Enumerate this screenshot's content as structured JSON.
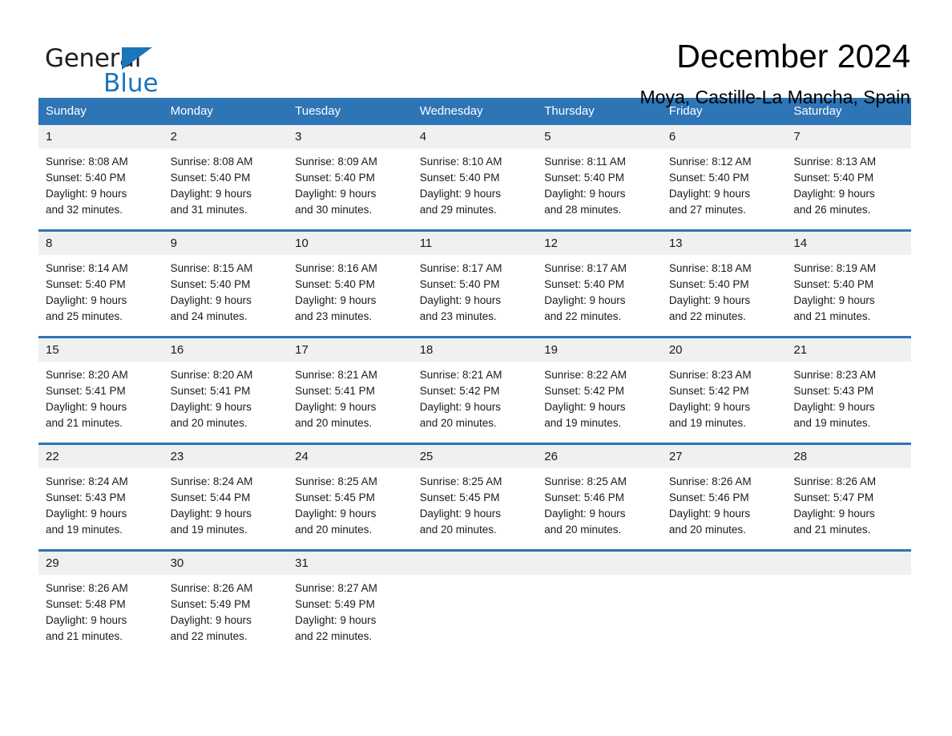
{
  "brand": {
    "name_top": "General",
    "name_bottom": "Blue",
    "accent_color": "#1b75bb"
  },
  "header": {
    "title": "December 2024",
    "location": "Moya, Castille-La Mancha, Spain"
  },
  "theme": {
    "header_blue": "#2e75b6",
    "date_band_gray": "#f0f0f0",
    "text_color": "#1a1a1a"
  },
  "weekday_headers": [
    "Sunday",
    "Monday",
    "Tuesday",
    "Wednesday",
    "Thursday",
    "Friday",
    "Saturday"
  ],
  "labels": {
    "sunrise_prefix": "Sunrise:",
    "sunset_prefix": "Sunset:",
    "daylight_prefix": "Daylight:"
  },
  "weeks": [
    [
      {
        "day": "1",
        "sunrise": "Sunrise: 8:08 AM",
        "sunset": "Sunset: 5:40 PM",
        "daylight_1": "Daylight: 9 hours",
        "daylight_2": "and 32 minutes."
      },
      {
        "day": "2",
        "sunrise": "Sunrise: 8:08 AM",
        "sunset": "Sunset: 5:40 PM",
        "daylight_1": "Daylight: 9 hours",
        "daylight_2": "and 31 minutes."
      },
      {
        "day": "3",
        "sunrise": "Sunrise: 8:09 AM",
        "sunset": "Sunset: 5:40 PM",
        "daylight_1": "Daylight: 9 hours",
        "daylight_2": "and 30 minutes."
      },
      {
        "day": "4",
        "sunrise": "Sunrise: 8:10 AM",
        "sunset": "Sunset: 5:40 PM",
        "daylight_1": "Daylight: 9 hours",
        "daylight_2": "and 29 minutes."
      },
      {
        "day": "5",
        "sunrise": "Sunrise: 8:11 AM",
        "sunset": "Sunset: 5:40 PM",
        "daylight_1": "Daylight: 9 hours",
        "daylight_2": "and 28 minutes."
      },
      {
        "day": "6",
        "sunrise": "Sunrise: 8:12 AM",
        "sunset": "Sunset: 5:40 PM",
        "daylight_1": "Daylight: 9 hours",
        "daylight_2": "and 27 minutes."
      },
      {
        "day": "7",
        "sunrise": "Sunrise: 8:13 AM",
        "sunset": "Sunset: 5:40 PM",
        "daylight_1": "Daylight: 9 hours",
        "daylight_2": "and 26 minutes."
      }
    ],
    [
      {
        "day": "8",
        "sunrise": "Sunrise: 8:14 AM",
        "sunset": "Sunset: 5:40 PM",
        "daylight_1": "Daylight: 9 hours",
        "daylight_2": "and 25 minutes."
      },
      {
        "day": "9",
        "sunrise": "Sunrise: 8:15 AM",
        "sunset": "Sunset: 5:40 PM",
        "daylight_1": "Daylight: 9 hours",
        "daylight_2": "and 24 minutes."
      },
      {
        "day": "10",
        "sunrise": "Sunrise: 8:16 AM",
        "sunset": "Sunset: 5:40 PM",
        "daylight_1": "Daylight: 9 hours",
        "daylight_2": "and 23 minutes."
      },
      {
        "day": "11",
        "sunrise": "Sunrise: 8:17 AM",
        "sunset": "Sunset: 5:40 PM",
        "daylight_1": "Daylight: 9 hours",
        "daylight_2": "and 23 minutes."
      },
      {
        "day": "12",
        "sunrise": "Sunrise: 8:17 AM",
        "sunset": "Sunset: 5:40 PM",
        "daylight_1": "Daylight: 9 hours",
        "daylight_2": "and 22 minutes."
      },
      {
        "day": "13",
        "sunrise": "Sunrise: 8:18 AM",
        "sunset": "Sunset: 5:40 PM",
        "daylight_1": "Daylight: 9 hours",
        "daylight_2": "and 22 minutes."
      },
      {
        "day": "14",
        "sunrise": "Sunrise: 8:19 AM",
        "sunset": "Sunset: 5:40 PM",
        "daylight_1": "Daylight: 9 hours",
        "daylight_2": "and 21 minutes."
      }
    ],
    [
      {
        "day": "15",
        "sunrise": "Sunrise: 8:20 AM",
        "sunset": "Sunset: 5:41 PM",
        "daylight_1": "Daylight: 9 hours",
        "daylight_2": "and 21 minutes."
      },
      {
        "day": "16",
        "sunrise": "Sunrise: 8:20 AM",
        "sunset": "Sunset: 5:41 PM",
        "daylight_1": "Daylight: 9 hours",
        "daylight_2": "and 20 minutes."
      },
      {
        "day": "17",
        "sunrise": "Sunrise: 8:21 AM",
        "sunset": "Sunset: 5:41 PM",
        "daylight_1": "Daylight: 9 hours",
        "daylight_2": "and 20 minutes."
      },
      {
        "day": "18",
        "sunrise": "Sunrise: 8:21 AM",
        "sunset": "Sunset: 5:42 PM",
        "daylight_1": "Daylight: 9 hours",
        "daylight_2": "and 20 minutes."
      },
      {
        "day": "19",
        "sunrise": "Sunrise: 8:22 AM",
        "sunset": "Sunset: 5:42 PM",
        "daylight_1": "Daylight: 9 hours",
        "daylight_2": "and 19 minutes."
      },
      {
        "day": "20",
        "sunrise": "Sunrise: 8:23 AM",
        "sunset": "Sunset: 5:42 PM",
        "daylight_1": "Daylight: 9 hours",
        "daylight_2": "and 19 minutes."
      },
      {
        "day": "21",
        "sunrise": "Sunrise: 8:23 AM",
        "sunset": "Sunset: 5:43 PM",
        "daylight_1": "Daylight: 9 hours",
        "daylight_2": "and 19 minutes."
      }
    ],
    [
      {
        "day": "22",
        "sunrise": "Sunrise: 8:24 AM",
        "sunset": "Sunset: 5:43 PM",
        "daylight_1": "Daylight: 9 hours",
        "daylight_2": "and 19 minutes."
      },
      {
        "day": "23",
        "sunrise": "Sunrise: 8:24 AM",
        "sunset": "Sunset: 5:44 PM",
        "daylight_1": "Daylight: 9 hours",
        "daylight_2": "and 19 minutes."
      },
      {
        "day": "24",
        "sunrise": "Sunrise: 8:25 AM",
        "sunset": "Sunset: 5:45 PM",
        "daylight_1": "Daylight: 9 hours",
        "daylight_2": "and 20 minutes."
      },
      {
        "day": "25",
        "sunrise": "Sunrise: 8:25 AM",
        "sunset": "Sunset: 5:45 PM",
        "daylight_1": "Daylight: 9 hours",
        "daylight_2": "and 20 minutes."
      },
      {
        "day": "26",
        "sunrise": "Sunrise: 8:25 AM",
        "sunset": "Sunset: 5:46 PM",
        "daylight_1": "Daylight: 9 hours",
        "daylight_2": "and 20 minutes."
      },
      {
        "day": "27",
        "sunrise": "Sunrise: 8:26 AM",
        "sunset": "Sunset: 5:46 PM",
        "daylight_1": "Daylight: 9 hours",
        "daylight_2": "and 20 minutes."
      },
      {
        "day": "28",
        "sunrise": "Sunrise: 8:26 AM",
        "sunset": "Sunset: 5:47 PM",
        "daylight_1": "Daylight: 9 hours",
        "daylight_2": "and 21 minutes."
      }
    ],
    [
      {
        "day": "29",
        "sunrise": "Sunrise: 8:26 AM",
        "sunset": "Sunset: 5:48 PM",
        "daylight_1": "Daylight: 9 hours",
        "daylight_2": "and 21 minutes."
      },
      {
        "day": "30",
        "sunrise": "Sunrise: 8:26 AM",
        "sunset": "Sunset: 5:49 PM",
        "daylight_1": "Daylight: 9 hours",
        "daylight_2": "and 22 minutes."
      },
      {
        "day": "31",
        "sunrise": "Sunrise: 8:27 AM",
        "sunset": "Sunset: 5:49 PM",
        "daylight_1": "Daylight: 9 hours",
        "daylight_2": "and 22 minutes."
      },
      {
        "day": "",
        "sunrise": "",
        "sunset": "",
        "daylight_1": "",
        "daylight_2": ""
      },
      {
        "day": "",
        "sunrise": "",
        "sunset": "",
        "daylight_1": "",
        "daylight_2": ""
      },
      {
        "day": "",
        "sunrise": "",
        "sunset": "",
        "daylight_1": "",
        "daylight_2": ""
      },
      {
        "day": "",
        "sunrise": "",
        "sunset": "",
        "daylight_1": "",
        "daylight_2": ""
      }
    ]
  ]
}
